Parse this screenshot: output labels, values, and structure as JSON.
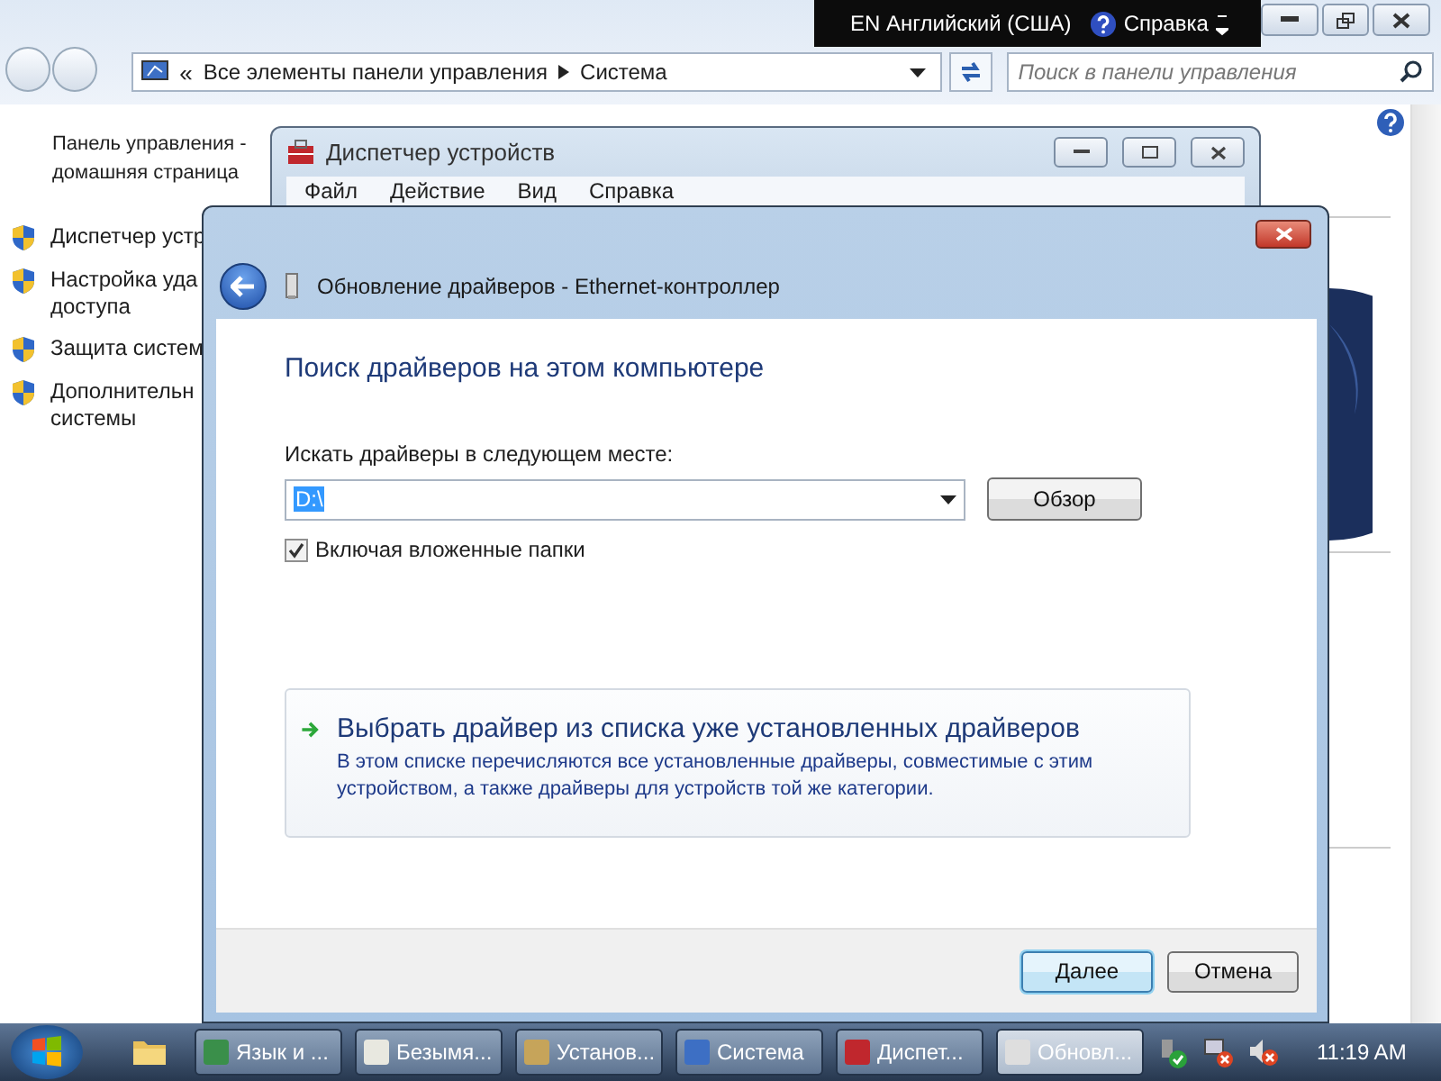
{
  "control_panel": {
    "breadcrumb_prefix": "«",
    "breadcrumb": [
      "Все элементы панели управления",
      "Система"
    ],
    "search": {
      "placeholder": "Поиск в панели управления"
    },
    "home_link": {
      "lines": [
        "Панель управления -",
        "домашняя страница"
      ]
    },
    "tasks": [
      {
        "lines": [
          "Диспетчер устр"
        ]
      },
      {
        "lines": [
          "Настройка уда",
          "доступа"
        ]
      },
      {
        "lines": [
          "Защита систем"
        ]
      },
      {
        "lines": [
          "Дополнительн",
          "системы"
        ]
      }
    ]
  },
  "language_bar": {
    "language": "EN Английский (США)",
    "help": "Справка"
  },
  "device_manager": {
    "title": "Диспетчер устройств",
    "menu": [
      "Файл",
      "Действие",
      "Вид",
      "Справка"
    ]
  },
  "dialog": {
    "title": "Обновление драйверов - Ethernet-контроллер",
    "heading": "Поиск драйверов на этом компьютере",
    "location_label": "Искать драйверы в следующем месте:",
    "location_value": "D:\\",
    "browse_button": "Обзор",
    "include_subfolders": {
      "label": "Включая вложенные папки",
      "checked": true
    },
    "option": {
      "title": "Выбрать драйвер из списка уже установленных драйверов",
      "description": "В этом списке перечисляются все установленные драйверы, совместимые с этим устройством, а также драйверы для устройств той же категории."
    },
    "buttons": [
      {
        "label": "Далее",
        "default": true
      },
      {
        "label": "Отмена",
        "default": false
      }
    ]
  },
  "taskbar": {
    "items": [
      {
        "label": "Язык и ...",
        "selected": false
      },
      {
        "label": "Безымя...",
        "selected": false
      },
      {
        "label": "Установ...",
        "selected": false
      },
      {
        "label": "Система",
        "selected": false
      },
      {
        "label": "Диспет...",
        "selected": false
      },
      {
        "label": "Обновл...",
        "selected": true
      }
    ],
    "clock": "11:19 AM"
  }
}
